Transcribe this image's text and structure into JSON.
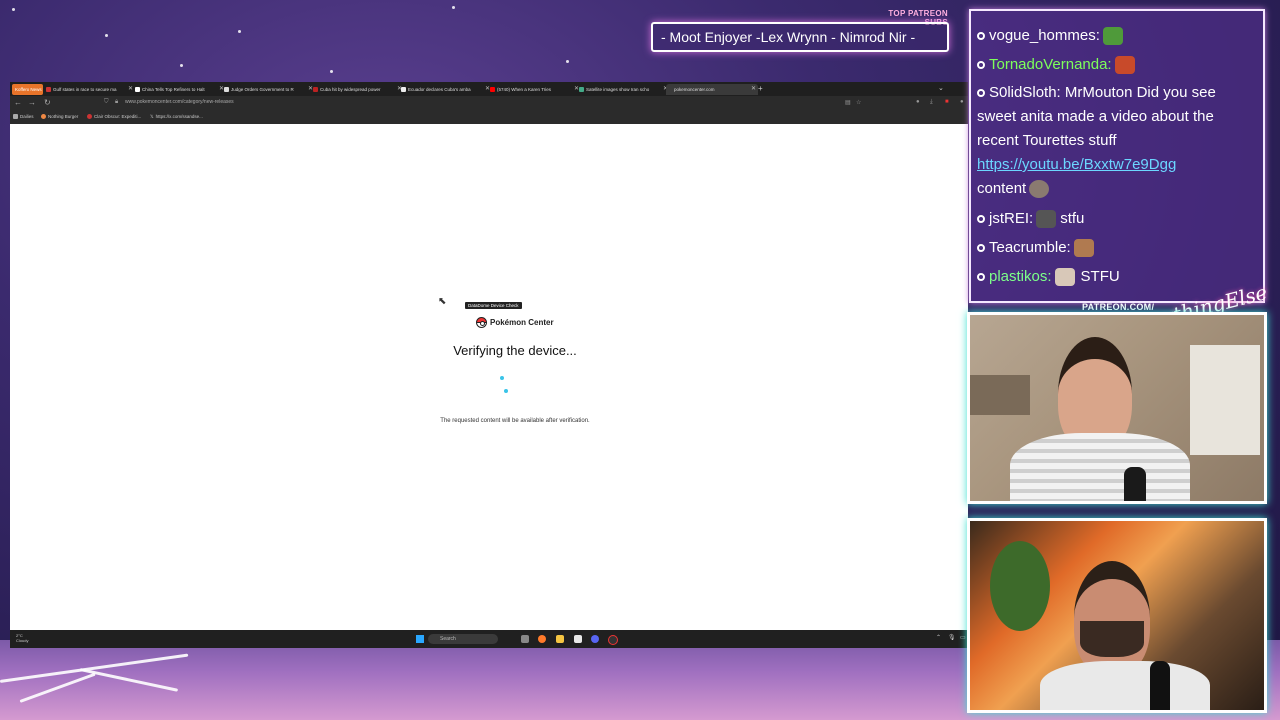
{
  "patreon": {
    "heading": "TOP PATREON SUBS",
    "names": "- Moot Enjoyer -Lex Wrynn - Nimrod Nir -"
  },
  "browser": {
    "tabs": [
      {
        "label": "Kofferx News",
        "active": false
      },
      {
        "label": "Gulf states in race to secure ma",
        "active": false
      },
      {
        "label": "China Tells Top Refiners to Halt",
        "active": false
      },
      {
        "label": "Judge Orders Government to R",
        "active": false
      },
      {
        "label": "Cuba hit by widespread power",
        "active": false
      },
      {
        "label": "Ecuador declares Cuba's amba",
        "active": false
      },
      {
        "label": "(5740) When a Karen Tries",
        "active": false
      },
      {
        "label": "Satellite images show Iran scho",
        "active": false
      },
      {
        "label": "pokemoncenter.com",
        "active": true
      }
    ],
    "url": "www.pokemoncenter.com/category/new-releases",
    "bookmarks": [
      {
        "label": "Dailies"
      },
      {
        "label": "Nothing Burger"
      },
      {
        "label": "Clair Obscur: Expediti..."
      },
      {
        "label": "https://x.com/ssandse..."
      }
    ]
  },
  "page": {
    "tooltip": "DataDome Device Check",
    "brand": "Pokémon Center",
    "heading": "Verifying the device...",
    "note": "The requested content will be available after verification."
  },
  "taskbar": {
    "weather_temp": "2°C",
    "weather_desc": "Cloudy",
    "search_placeholder": "Search"
  },
  "chat": {
    "messages": [
      {
        "user": "vogue_hommes:",
        "text": "",
        "color": "#ffffff"
      },
      {
        "user": "TornadoVernanda:",
        "text": "",
        "color": "#7dff5a"
      },
      {
        "user": "S0lidSloth:",
        "text": "MrMouton Did you see sweet anita made a video about the recent Tourettes stuff",
        "link": "https://youtu.be/Bxxtw7e9Dgg",
        "tail": "content",
        "color": "#ffffff"
      },
      {
        "user": "jstREI:",
        "text": "stfu",
        "color": "#ffffff"
      },
      {
        "user": "Teacrumble:",
        "text": "",
        "color": "#ffffff"
      },
      {
        "user": "plastikos:",
        "text": "STFU",
        "color": "#7dff8a"
      }
    ]
  },
  "cams": {
    "patreon_label": "PATREON.COM/",
    "brand": "AnythingElse"
  }
}
